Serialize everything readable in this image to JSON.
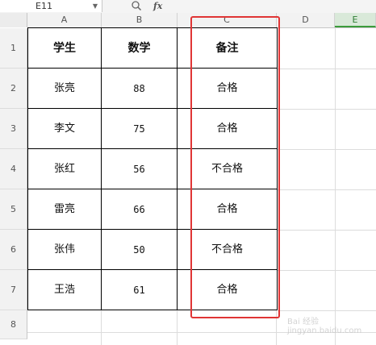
{
  "name_box": {
    "value": "E11",
    "dropdown_icon": "chevron-down-icon"
  },
  "formula_tools": {
    "zoom_icon": "magnifier-icon",
    "fx_label": "fx"
  },
  "columns": [
    "A",
    "B",
    "C",
    "D",
    "E"
  ],
  "rows": [
    "1",
    "2",
    "3",
    "4",
    "5",
    "6",
    "7",
    "8"
  ],
  "table": {
    "headers": [
      "学生",
      "数学",
      "备注"
    ],
    "data": [
      [
        "张亮",
        "88",
        "合格"
      ],
      [
        "李文",
        "75",
        "合格"
      ],
      [
        "张红",
        "56",
        "不合格"
      ],
      [
        "雷亮",
        "66",
        "合格"
      ],
      [
        "张伟",
        "50",
        "不合格"
      ],
      [
        "王浩",
        "61",
        "合格"
      ]
    ]
  },
  "watermark": {
    "text": "Bai 经验 jingyan.baidu.com"
  },
  "colors": {
    "highlight": "#e03535",
    "selected_col": "#3a9b3a"
  }
}
